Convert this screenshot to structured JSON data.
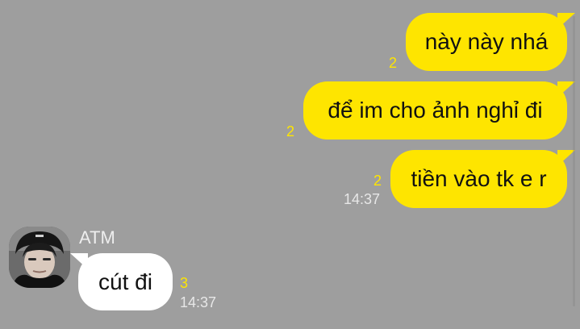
{
  "messages_out": [
    {
      "text": "này này nhá",
      "unread": "2"
    },
    {
      "text": "để im cho ảnh nghỉ đi",
      "unread": "2"
    },
    {
      "text": "tiền vào tk e r",
      "unread": "2",
      "time": "14:37"
    }
  ],
  "message_in": {
    "sender": "ATM",
    "text": "cút đi",
    "unread": "3",
    "time": "14:37"
  },
  "colors": {
    "background": "#9e9e9e",
    "outgoing_bubble": "#fee500",
    "incoming_bubble": "#ffffff",
    "unread_count": "#fee500"
  },
  "icons": {
    "avatar": "user-avatar-photo"
  }
}
